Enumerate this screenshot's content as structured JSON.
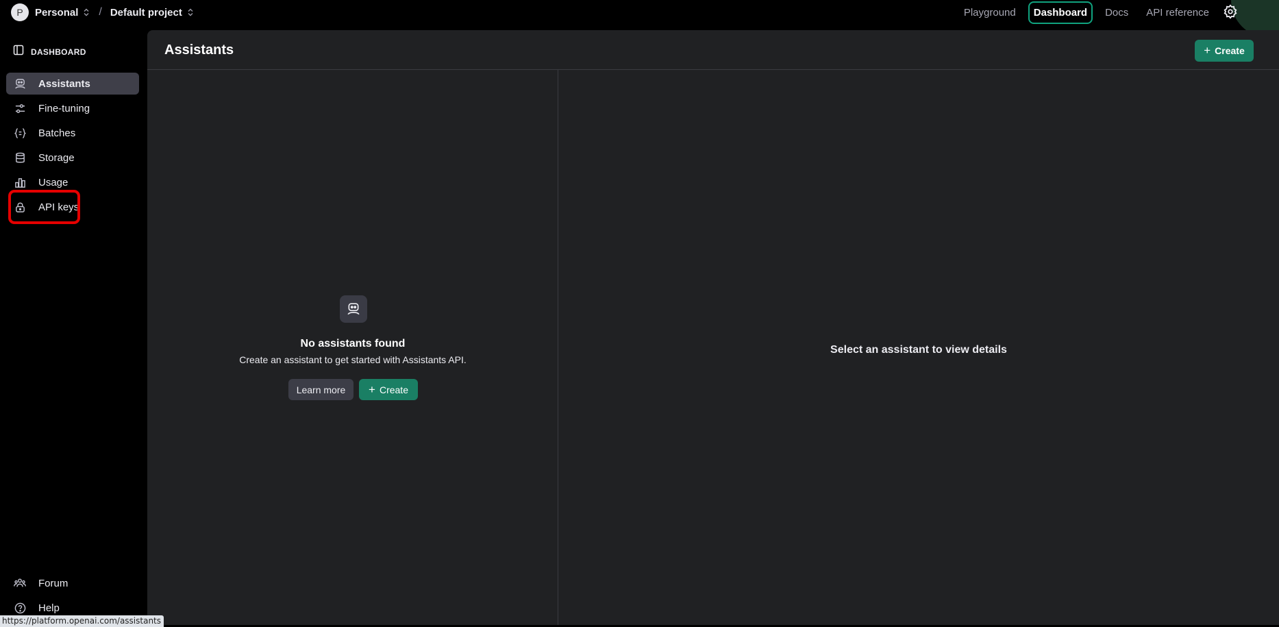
{
  "topbar": {
    "org_initial": "P",
    "org_name": "Personal",
    "separator": "/",
    "project_name": "Default project",
    "nav": {
      "playground": "Playground",
      "dashboard": "Dashboard",
      "docs": "Docs",
      "api_reference": "API reference"
    }
  },
  "sidebar": {
    "heading": "DASHBOARD",
    "items": [
      {
        "label": "Assistants",
        "icon": "robot-icon"
      },
      {
        "label": "Fine-tuning",
        "icon": "sliders-icon"
      },
      {
        "label": "Batches",
        "icon": "braces-icon"
      },
      {
        "label": "Storage",
        "icon": "database-icon"
      },
      {
        "label": "Usage",
        "icon": "bar-chart-icon"
      },
      {
        "label": "API keys",
        "icon": "lock-icon"
      }
    ],
    "footer": [
      {
        "label": "Forum",
        "icon": "people-icon"
      },
      {
        "label": "Help",
        "icon": "help-circle-icon"
      }
    ]
  },
  "main": {
    "title": "Assistants",
    "create_label": "Create",
    "empty": {
      "title": "No assistants found",
      "subtitle": "Create an assistant to get started with Assistants API.",
      "learn_more": "Learn more",
      "create": "Create"
    },
    "detail_placeholder": "Select an assistant to view details"
  },
  "status_bar": {
    "url": "https://platform.openai.com/assistants"
  },
  "colors": {
    "accent_green": "#1a7f64",
    "active_outline": "#10a37f",
    "highlight_red": "#e50000"
  }
}
